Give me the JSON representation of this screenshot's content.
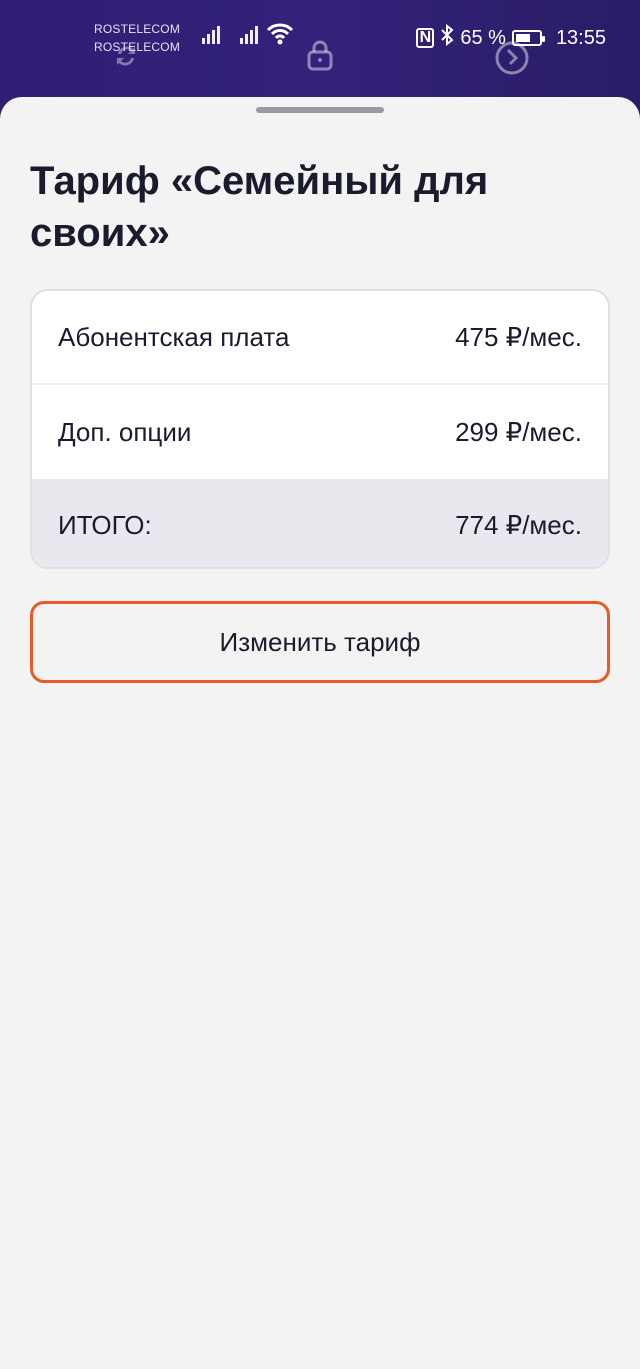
{
  "status_bar": {
    "carrier_1": "ROSTELECOM",
    "carrier_2": "ROSTELECOM",
    "battery_percent": "65 %",
    "battery_level": 0.65,
    "time": "13:55"
  },
  "sheet": {
    "title": "Тариф «Семейный для своих»",
    "rows": [
      {
        "label": "Абонентская плата",
        "value": "475 ₽/мес."
      },
      {
        "label": "Доп. опции",
        "value": "299 ₽/мес."
      }
    ],
    "total": {
      "label": "ИТОГО:",
      "value": "774 ₽/мес."
    },
    "change_button_label": "Изменить тариф"
  },
  "colors": {
    "accent_border": "#ea5a26",
    "backdrop": "#2f1e73",
    "sheet_bg": "#f3f3f3",
    "total_row_bg": "#e8e8ee",
    "text_primary": "#1a1c2e"
  }
}
